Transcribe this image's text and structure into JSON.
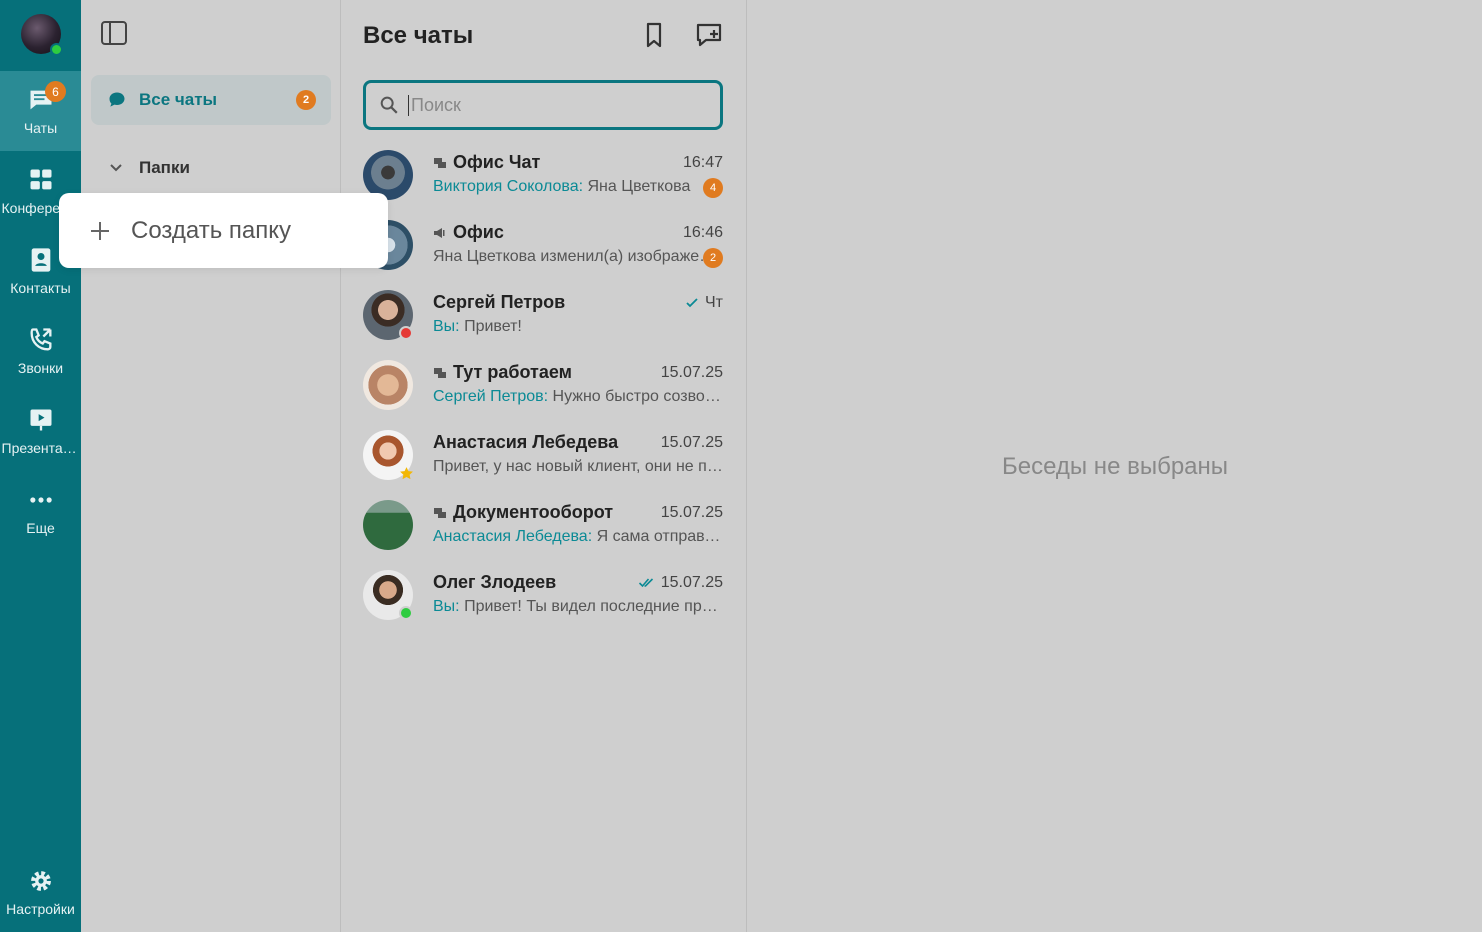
{
  "rail": {
    "items": [
      {
        "label": "Чаты",
        "badge": "6"
      },
      {
        "label": "Конференции"
      },
      {
        "label": "Контакты"
      },
      {
        "label": "Звонки"
      },
      {
        "label": "Презентации"
      },
      {
        "label": "Еще"
      }
    ],
    "settings_label": "Настройки"
  },
  "folders": {
    "all_chats_label": "Все чаты",
    "all_chats_badge": "2",
    "folders_label": "Папки",
    "create_folder_label": "Создать папку"
  },
  "chatlist": {
    "title": "Все чаты",
    "search_placeholder": "Поиск",
    "chats": [
      {
        "name": "Офис Чат",
        "time": "16:47",
        "who": "Виктория Соколова:",
        "text": " Яна Цветкова",
        "badge": "4",
        "icon": "group-chat-icon"
      },
      {
        "name": "Офис",
        "time": "16:46",
        "who": "",
        "text": "Яна Цветкова изменил(а) изображение",
        "badge": "2",
        "icon": "channel-icon"
      },
      {
        "name": "Сергей Петров",
        "time": "Чт",
        "who": "Вы:",
        "text": " Привет!",
        "status": "busy",
        "check": "single"
      },
      {
        "name": "Тут работаем",
        "time": "15.07.25",
        "who": "Сергей Петров:",
        "text": " Нужно быстро созвониться",
        "icon": "group-chat-icon"
      },
      {
        "name": "Анастасия Лебедева",
        "time": "15.07.25",
        "who": "",
        "text": "Привет, у нас новый клиент, они не против",
        "status": "favorite"
      },
      {
        "name": "Документооборот",
        "time": "15.07.25",
        "who": "Анастасия Лебедева:",
        "text": " Я сама отправлю",
        "icon": "group-chat-icon"
      },
      {
        "name": "Олег Злодеев",
        "time": "15.07.25",
        "who": "Вы:",
        "text": " Привет! Ты видел последние правки?",
        "status": "online",
        "check": "double"
      }
    ]
  },
  "empty_state": "Беседы не выбраны",
  "colors": {
    "accent": "#06707a",
    "badge": "#e07b20",
    "link": "#0b8a95"
  }
}
